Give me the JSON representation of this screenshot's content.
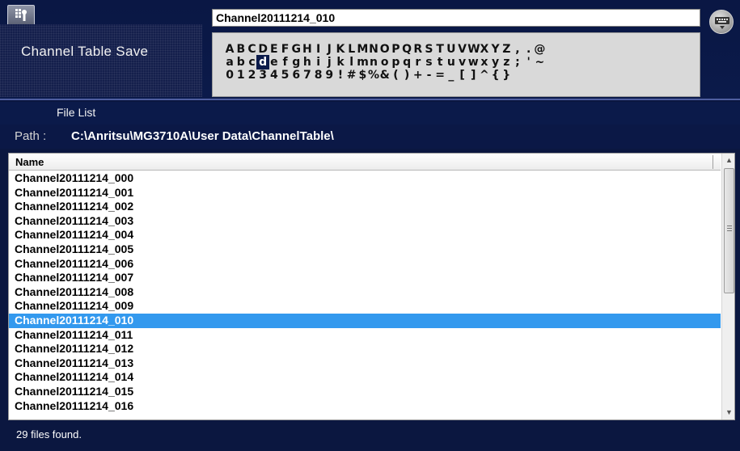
{
  "header": {
    "title": "Channel Table Save",
    "filename_value": "Channel20111214_010",
    "menu_icon": "touch-menu-icon",
    "keyboard_icon": "keyboard-icon"
  },
  "char_panel": {
    "rows": [
      [
        "A",
        "B",
        "C",
        "D",
        "E",
        "F",
        "G",
        "H",
        "I",
        "J",
        "K",
        "L",
        "M",
        "N",
        "O",
        "P",
        "Q",
        "R",
        "S",
        "T",
        "U",
        "V",
        "W",
        "X",
        "Y",
        "Z",
        ",",
        ".",
        "@"
      ],
      [
        "a",
        "b",
        "c",
        "d",
        "e",
        "f",
        "g",
        "h",
        "i",
        "j",
        "k",
        "l",
        "m",
        "n",
        "o",
        "p",
        "q",
        "r",
        "s",
        "t",
        "u",
        "v",
        "w",
        "x",
        "y",
        "z",
        ";",
        "'",
        "~"
      ],
      [
        "0",
        "1",
        "2",
        "3",
        "4",
        "5",
        "6",
        "7",
        "8",
        "9",
        "!",
        "#",
        "$",
        "%",
        "&",
        "(",
        ")",
        "+",
        "-",
        "=",
        "_",
        "[",
        "]",
        "^",
        "{",
        "}"
      ]
    ],
    "selected_char": "d"
  },
  "file_list": {
    "section_title": "File List",
    "path_label": "Path :",
    "path_value": "C:\\Anritsu\\MG3710A\\User Data\\ChannelTable\\",
    "column_name": "Name",
    "files": [
      "Channel20111214_000",
      "Channel20111214_001",
      "Channel20111214_002",
      "Channel20111214_003",
      "Channel20111214_004",
      "Channel20111214_005",
      "Channel20111214_006",
      "Channel20111214_007",
      "Channel20111214_008",
      "Channel20111214_009",
      "Channel20111214_010",
      "Channel20111214_011",
      "Channel20111214_012",
      "Channel20111214_013",
      "Channel20111214_014",
      "Channel20111214_015",
      "Channel20111214_016"
    ],
    "selected_file": "Channel20111214_010"
  },
  "status": {
    "text": "29 files found."
  },
  "colors": {
    "background": "#0b1740",
    "selection": "#3399ee",
    "char_panel": "#d9d9d9"
  }
}
